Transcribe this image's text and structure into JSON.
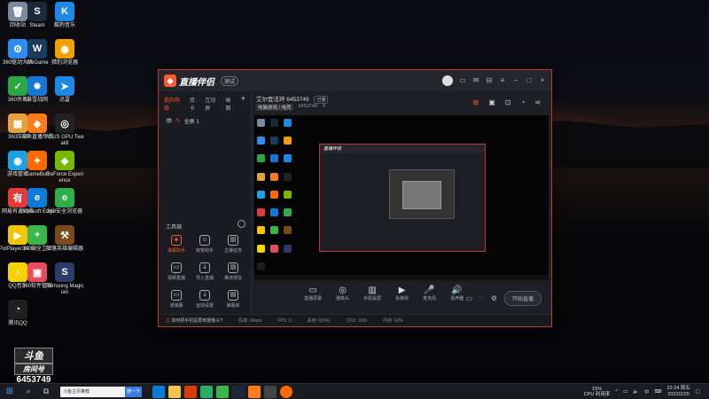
{
  "desktop": {
    "icons": [
      {
        "label": "回收站",
        "color": "#7a8aa0",
        "glyph": "🗑"
      },
      {
        "label": "Steam",
        "color": "#1b2838",
        "glyph": "S"
      },
      {
        "label": "酷狗音乐",
        "color": "#1e88e5",
        "glyph": "K"
      },
      {
        "label": "360驱动大师",
        "color": "#2d8cf0",
        "glyph": "⚙"
      },
      {
        "label": "WeGame",
        "color": "#1a3b5c",
        "glyph": "W"
      },
      {
        "label": "猎豹浏览器",
        "color": "#f0a000",
        "glyph": "◉"
      },
      {
        "label": "360杀毒",
        "color": "#29a745",
        "glyph": "✓"
      },
      {
        "label": "暴雪战网",
        "color": "#1976d2",
        "glyph": "✸"
      },
      {
        "label": "迅雷",
        "color": "#1e88e5",
        "glyph": "➤"
      },
      {
        "label": "360压缩",
        "color": "#e6a23c",
        "glyph": "▦"
      },
      {
        "label": "斗鱼直播伴侣",
        "color": "#ff7a1a",
        "glyph": "◆"
      },
      {
        "label": "ASUS GPU Tweakll",
        "color": "#222",
        "glyph": "◎"
      },
      {
        "label": "游戏管家",
        "color": "#1aa1e6",
        "glyph": "◉"
      },
      {
        "label": "GameBuff",
        "color": "#ff6a00",
        "glyph": "✦"
      },
      {
        "label": "GeForce Experience",
        "color": "#76b900",
        "glyph": "◈"
      },
      {
        "label": "网易有道词典",
        "color": "#e53935",
        "glyph": "有"
      },
      {
        "label": "Microsoft Edge",
        "color": "#0c7bd8",
        "glyph": "e"
      },
      {
        "label": "360安全浏览器",
        "color": "#2eaf48",
        "glyph": "e"
      },
      {
        "label": "PotPlayer 64 bit",
        "color": "#f5c400",
        "glyph": "▶"
      },
      {
        "label": "360安全卫士",
        "color": "#3cb54a",
        "glyph": "+"
      },
      {
        "label": "部落英雄编辑器",
        "color": "#7a4a1a",
        "glyph": "⚒"
      },
      {
        "label": "QQ音乐",
        "color": "#f5d300",
        "glyph": "♪"
      },
      {
        "label": "360软件管家",
        "color": "#e84a5f",
        "glyph": "▣"
      },
      {
        "label": "Samsung Magician",
        "color": "#2b3a67",
        "glyph": "S"
      },
      {
        "label": "腾讯QQ",
        "color": "#1e1e1e",
        "glyph": "◔"
      }
    ]
  },
  "app": {
    "logo_text": "直播伴侣",
    "version_badge": "测试",
    "tabs": [
      "我的布局",
      "双卡",
      "互动屏",
      "画面"
    ],
    "tabs_plus": "+",
    "scene_label": "全屏 1",
    "room_title": "艾尔登法环 6453749",
    "room_tag": "已播",
    "room_meta_cat": "电脑游戏 / 电竞",
    "room_meta_id": "6453749",
    "room_meta_zero": "0",
    "toolbox_title": "工具箱",
    "tools": [
      {
        "label": "弹幕助手",
        "glyph": "◈",
        "accent": true
      },
      {
        "label": "房管助手",
        "glyph": "☺",
        "accent": false
      },
      {
        "label": "主播任务",
        "glyph": "▤",
        "accent": false
      },
      {
        "label": "视频直播",
        "glyph": "▭",
        "accent": false
      },
      {
        "label": "导入直播",
        "glyph": "⇣",
        "accent": false
      },
      {
        "label": "推流地址",
        "glyph": "▤",
        "accent": false
      },
      {
        "label": "波弹幕",
        "glyph": "▭",
        "accent": false
      },
      {
        "label": "运动设置",
        "glyph": "⇣",
        "accent": false
      },
      {
        "label": "弹幕库",
        "glyph": "▤",
        "accent": false
      }
    ],
    "bottom_controls": [
      {
        "label": "直播屏幕",
        "glyph": "▭"
      },
      {
        "label": "摄像头",
        "glyph": "◎"
      },
      {
        "label": "手机投屏",
        "glyph": "▥"
      },
      {
        "label": "多媒体",
        "glyph": "▶"
      },
      {
        "label": "麦克风",
        "glyph": "🎤"
      },
      {
        "label": "扬声器",
        "glyph": "🔊"
      }
    ],
    "start_live_label": "开始直播",
    "status_question": "如何把手机投屏到摄像头?",
    "status_items": [
      "码率: 0kbps",
      "FPS: 0",
      "丢帧: 0(0%)",
      "CPU: 16%",
      "内存: 52%"
    ],
    "nested_logo_text": "直播伴侣"
  },
  "watermark": {
    "logo": "斗鱼",
    "sub": "房间号",
    "room_number": "6453749"
  },
  "taskbar": {
    "search_placeholder": "斗鱼主页推荐",
    "search_go": "搜一下",
    "cpu_label": "15%",
    "cpu_sub": "CPU 利用率",
    "lang": "中",
    "time": "22:24 周五",
    "date": "2022/2/25"
  }
}
